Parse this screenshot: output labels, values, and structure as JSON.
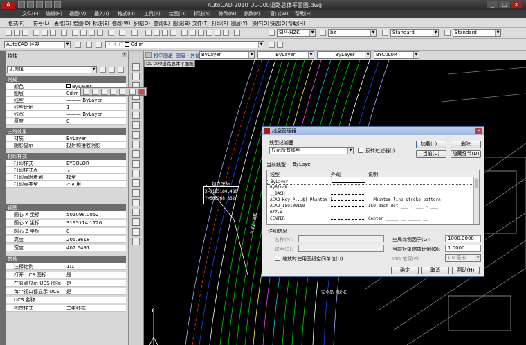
{
  "app": {
    "title": "AutoCAD 2010 DL-000道路总体平面图.dwg",
    "logo": "A"
  },
  "menu": [
    "文件(F)",
    "编辑(E)",
    "视图(V)",
    "插入(I)",
    "格式(O)",
    "工具(T)",
    "绘图(D)",
    "标注(N)",
    "修改(M)",
    "参数(P)",
    "窗口(W)",
    "帮助(H)"
  ],
  "toolbar1": {
    "labels": [
      "格式(F)",
      "符号(L)",
      "表格(G)",
      "绘图(D)",
      "标注(E)",
      "修改(W)",
      "多线(Q)",
      "查询(L)",
      "图块(B)",
      "文件(T)",
      "打印(P)",
      "图层(Y)",
      "操作(O)",
      "快选(Q)",
      "帮助(H)"
    ]
  },
  "toolbar2": {
    "textstyle": "SIM-HZK",
    "dimstyle": "bz",
    "tablestyle": "Standard",
    "mlstyle": "Standard"
  },
  "toolbar3": {
    "workspace": "AutoCAD 经典",
    "layer": "0dim"
  },
  "props": {
    "title": "特性",
    "selection": "无选择",
    "sections": [
      {
        "name": "常规",
        "rows": [
          [
            "颜色",
            "ByLayer"
          ],
          [
            "图层",
            "0dim"
          ],
          [
            "线型",
            "——— ByLayer"
          ],
          [
            "线型比例",
            "1"
          ],
          [
            "线宽",
            "——— ByLayer"
          ],
          [
            "厚度",
            "0"
          ]
        ]
      },
      {
        "name": "三维效果",
        "rows": [
          [
            "材质",
            "ByLayer"
          ],
          [
            "阴影显示",
            "投射和接收阴影"
          ]
        ]
      },
      {
        "name": "打印样式",
        "rows": [
          [
            "打印样式",
            "BYCOLOR"
          ],
          [
            "打印样式表",
            "无"
          ],
          [
            "打印表附着到",
            "模型"
          ],
          [
            "打印表类型",
            "不可用"
          ]
        ]
      },
      {
        "name": "视图",
        "rows": [
          [
            "圆心 X 坐标",
            "501098.0052"
          ],
          [
            "圆心 Y 坐标",
            "3195114.1726"
          ],
          [
            "圆心 Z 坐标",
            "0"
          ],
          [
            "高度",
            "205.3618"
          ],
          [
            "宽度",
            "402.6491"
          ]
        ]
      },
      {
        "name": "其他",
        "rows": [
          [
            "注释比例",
            "1:1"
          ],
          [
            "打开 UCS 图标",
            "是"
          ],
          [
            "在原点显示 UCS 图标",
            "是"
          ],
          [
            "每个视口都显示 UCS",
            "是"
          ],
          [
            "UCS 名称",
            ""
          ],
          [
            "视觉样式",
            "二维线框"
          ]
        ]
      }
    ]
  },
  "tabs": {
    "print": "打印图纸",
    "layer": "图层 - 其他",
    "color": "ByLayer",
    "lt1": "——— ByLayer",
    "lt2": "——— ByLayer",
    "plot": "BYC0L0R",
    "doc": "DL-000道路总体平面图"
  },
  "cad": {
    "coord_label": "起点坐标",
    "coord_x": "X=3195100.488",
    "coord_y": "Y=500968.832",
    "station": "A K0+000",
    "axis": "Y",
    "ref_text": "安全岛（绿化）"
  },
  "dialog": {
    "title": "线型管理器",
    "filter_label": "线型过滤器",
    "filter_value": "显示所有线型",
    "invert": "反转过滤器(I)",
    "load": "加载(L)...",
    "delete": "删除",
    "current_btn": "当前(C)",
    "hide_details": "隐藏细节(D)",
    "current_label": "当前线型:",
    "current_value": "ByLayer",
    "col_linetype": "线型",
    "col_appearance": "外观",
    "col_desc": "说明",
    "linetypes": [
      [
        "ByLayer",
        "",
        ""
      ],
      [
        "ByBlock",
        "",
        ""
      ],
      [
        "__DASH",
        "",
        ""
      ],
      [
        "ACAD-Key P...$( Phantom )",
        "",
        "— Phantom line stroke pattern"
      ],
      [
        "ACAD_ISO10W100",
        "",
        "ISO dash dot ___ . ___ . ___"
      ],
      [
        "BZZ-4",
        "",
        ""
      ],
      [
        "CENTER",
        "",
        "Center _____ __ _____ __"
      ]
    ],
    "details": "详细信息",
    "name_label": "名称(N):",
    "desc_label": "说明(E):",
    "global_scale_label": "全局比例因子(G):",
    "global_scale": "1000.0000",
    "cur_scale_label": "当前对象缩放比例(O):",
    "cur_scale": "1.0000",
    "iso_label": "ISO 笔宽(P):",
    "iso_value": "1.0 毫米",
    "paper_units": "缩放时使用图纸空间单位(U)",
    "ok": "确定",
    "cancel": "取消",
    "help": "帮助(H)"
  }
}
